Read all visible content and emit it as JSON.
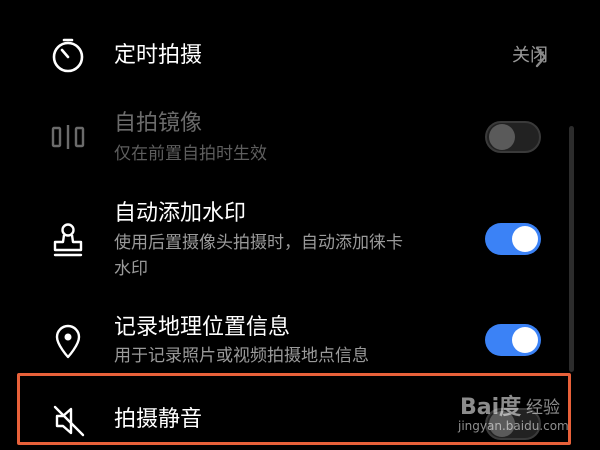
{
  "settings": [
    {
      "title": "定时拍摄",
      "value": "关闭"
    },
    {
      "title": "自拍镜像",
      "subtitle": "仅在前置自拍时生效",
      "toggle": "off",
      "enabled": false
    },
    {
      "title": "自动添加水印",
      "subtitle_line1": "使用后置摄像头拍摄时，自动添加徕卡",
      "subtitle_line2": "水印",
      "toggle": "on"
    },
    {
      "title": "记录地理位置信息",
      "subtitle": "用于记录照片或视频拍摄地点信息",
      "toggle": "on"
    },
    {
      "title": "拍摄静音",
      "toggle": "off"
    }
  ],
  "icons": [
    "timer-icon",
    "mirror-icon",
    "stamp-icon",
    "location-icon",
    "mute-icon",
    "chevron-right-icon"
  ],
  "watermark": {
    "logo": "Bai度",
    "label": "经验",
    "url": "jingyan.baidu.com"
  },
  "colors": {
    "background": "#000000",
    "toggle_on": "#3b82f6",
    "highlight": "#e8613a",
    "secondary_text": "#9a9a9a"
  }
}
